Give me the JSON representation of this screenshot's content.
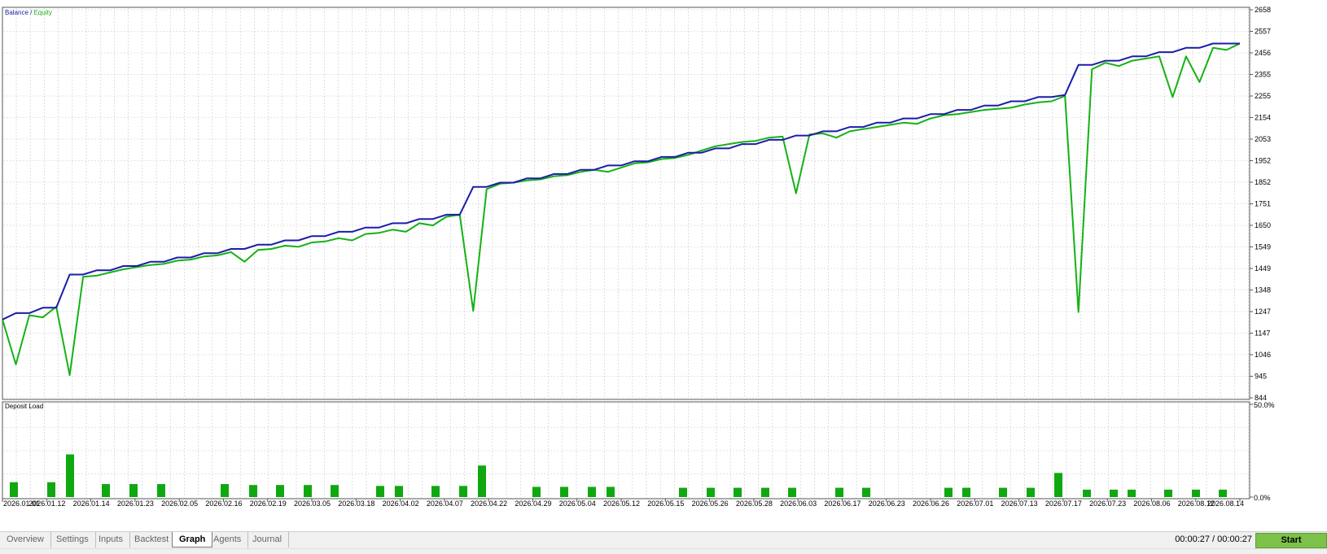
{
  "balance_chart": {
    "legend": {
      "balance": "Balance",
      "separator": " / ",
      "equity": "Equity"
    },
    "colors": {
      "balance": "#1c1ca8",
      "equity": "#14b214",
      "grid": "#c8c8c8"
    },
    "y_ticks": [
      "2658",
      "2557",
      "2456",
      "2355",
      "2255",
      "2154",
      "2053",
      "1952",
      "1852",
      "1751",
      "1650",
      "1549",
      "1449",
      "1348",
      "1247",
      "1147",
      "1046",
      "945",
      "844"
    ]
  },
  "deposit_chart": {
    "title": "Deposit Load",
    "y_ticks": [
      "50.0%",
      "0.0%"
    ],
    "color": "#10a810"
  },
  "x_dates": [
    "2026.01.01",
    "2026.01.12",
    "2026.01.14",
    "2026.01.23",
    "2026.02.05",
    "2026.02.16",
    "2026.02.19",
    "2026.03.05",
    "2026.03.18",
    "2026.04.02",
    "2026.04.07",
    "2026.04.22",
    "2026.04.29",
    "2026.05.04",
    "2026.05.12",
    "2026.05.15",
    "2026.05.26",
    "2026.05.28",
    "2026.06.03",
    "2026.06.17",
    "2026.06.23",
    "2026.06.26",
    "2026.07.01",
    "2026.07.13",
    "2026.07.17",
    "2026.07.23",
    "2026.08.06",
    "2026.08.12",
    "2026.08.14"
  ],
  "chart_data": [
    {
      "type": "line",
      "legend": [
        "Balance",
        "Equity"
      ],
      "ylim": [
        844,
        2658
      ],
      "grid": true,
      "series": [
        {
          "name": "Balance",
          "values": [
            1210,
            1240,
            1240,
            1265,
            1265,
            1420,
            1420,
            1440,
            1440,
            1460,
            1460,
            1480,
            1480,
            1500,
            1500,
            1520,
            1520,
            1540,
            1540,
            1560,
            1560,
            1580,
            1580,
            1600,
            1600,
            1620,
            1620,
            1640,
            1640,
            1660,
            1660,
            1680,
            1680,
            1700,
            1700,
            1830,
            1830,
            1850,
            1850,
            1870,
            1870,
            1890,
            1890,
            1910,
            1910,
            1930,
            1930,
            1950,
            1950,
            1970,
            1970,
            1990,
            1990,
            2010,
            2010,
            2030,
            2030,
            2050,
            2050,
            2070,
            2070,
            2090,
            2090,
            2110,
            2110,
            2130,
            2130,
            2150,
            2150,
            2170,
            2170,
            2190,
            2190,
            2210,
            2210,
            2230,
            2230,
            2250,
            2250,
            2260,
            2400,
            2400,
            2420,
            2420,
            2440,
            2440,
            2460,
            2460,
            2480,
            2480,
            2500,
            2500,
            2500
          ]
        },
        {
          "name": "Equity",
          "values": [
            1210,
            1000,
            1230,
            1220,
            1270,
            950,
            1410,
            1415,
            1430,
            1445,
            1455,
            1465,
            1470,
            1485,
            1490,
            1505,
            1510,
            1525,
            1480,
            1535,
            1540,
            1555,
            1550,
            1570,
            1575,
            1590,
            1580,
            1610,
            1615,
            1630,
            1620,
            1660,
            1650,
            1690,
            1700,
            1250,
            1820,
            1845,
            1850,
            1860,
            1865,
            1880,
            1885,
            1900,
            1910,
            1900,
            1920,
            1940,
            1945,
            1960,
            1965,
            1980,
            2000,
            2020,
            2030,
            2040,
            2045,
            2060,
            2065,
            1800,
            2075,
            2080,
            2060,
            2090,
            2100,
            2110,
            2120,
            2130,
            2125,
            2150,
            2165,
            2170,
            2180,
            2190,
            2195,
            2200,
            2215,
            2225,
            2230,
            2255,
            1245,
            2380,
            2410,
            2395,
            2420,
            2430,
            2440,
            2250,
            2440,
            2320,
            2480,
            2470,
            2500
          ]
        }
      ]
    },
    {
      "type": "bar",
      "title": "Deposit Load",
      "ylim": [
        0,
        50
      ],
      "values": [
        {
          "x": 17,
          "v": 8
        },
        {
          "x": 63,
          "v": 8
        },
        {
          "x": 86,
          "v": 23
        },
        {
          "x": 130,
          "v": 7
        },
        {
          "x": 164,
          "v": 7
        },
        {
          "x": 198,
          "v": 7
        },
        {
          "x": 276,
          "v": 7
        },
        {
          "x": 311,
          "v": 6.5
        },
        {
          "x": 344,
          "v": 6.5
        },
        {
          "x": 378,
          "v": 6.5
        },
        {
          "x": 411,
          "v": 6.5
        },
        {
          "x": 467,
          "v": 6
        },
        {
          "x": 490,
          "v": 6
        },
        {
          "x": 535,
          "v": 6
        },
        {
          "x": 569,
          "v": 6
        },
        {
          "x": 592,
          "v": 17
        },
        {
          "x": 659,
          "v": 5.5
        },
        {
          "x": 693,
          "v": 5.5
        },
        {
          "x": 727,
          "v": 5.5
        },
        {
          "x": 750,
          "v": 5.5
        },
        {
          "x": 839,
          "v": 5
        },
        {
          "x": 873,
          "v": 5
        },
        {
          "x": 906,
          "v": 5
        },
        {
          "x": 940,
          "v": 5
        },
        {
          "x": 973,
          "v": 5
        },
        {
          "x": 1031,
          "v": 5
        },
        {
          "x": 1064,
          "v": 5
        },
        {
          "x": 1165,
          "v": 5
        },
        {
          "x": 1187,
          "v": 5
        },
        {
          "x": 1232,
          "v": 5
        },
        {
          "x": 1266,
          "v": 5
        },
        {
          "x": 1300,
          "v": 13
        },
        {
          "x": 1335,
          "v": 4
        },
        {
          "x": 1368,
          "v": 4
        },
        {
          "x": 1390,
          "v": 4
        },
        {
          "x": 1435,
          "v": 4
        },
        {
          "x": 1469,
          "v": 4
        },
        {
          "x": 1502,
          "v": 4
        }
      ]
    }
  ],
  "tabs": [
    "Overview",
    "Settings",
    "Inputs",
    "Backtest",
    "Graph",
    "Agents",
    "Journal"
  ],
  "active_tab": "Graph",
  "timer": "00:00:27 / 00:00:27",
  "start_button": "Start"
}
